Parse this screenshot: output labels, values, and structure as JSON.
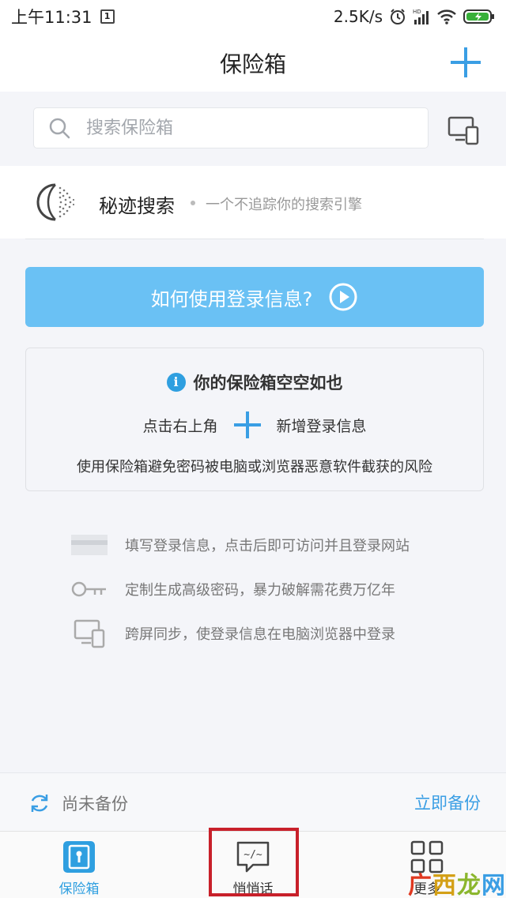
{
  "status_bar": {
    "time": "上午11:31",
    "sim": "1",
    "net_speed": "2.5K/s"
  },
  "header": {
    "title": "保险箱",
    "add_icon": "plus-icon"
  },
  "search": {
    "placeholder": "搜索保险箱",
    "devices_icon": "devices-icon"
  },
  "secret_search": {
    "title": "秘迹搜索",
    "description": "一个不追踪你的搜索引擎"
  },
  "howto": {
    "label": "如何使用登录信息?"
  },
  "empty_state": {
    "title": "你的保险箱空空如也",
    "hint_left": "点击右上角",
    "hint_right": "新增登录信息",
    "description": "使用保险箱避免密码被电脑或浏览器恶意软件截获的风险"
  },
  "features": [
    {
      "icon": "card-icon",
      "text": "填写登录信息，点击后即可访问并且登录网站"
    },
    {
      "icon": "key-icon",
      "text": "定制生成高级密码，暴力破解需花费万亿年"
    },
    {
      "icon": "devices-icon",
      "text": "跨屏同步，使登录信息在电脑浏览器中登录"
    }
  ],
  "backup": {
    "status": "尚未备份",
    "action": "立即备份"
  },
  "tabs": [
    {
      "label": "保险箱",
      "icon": "safe-icon",
      "active": true
    },
    {
      "label": "悄悄话",
      "icon": "chat-code-icon",
      "active": false
    },
    {
      "label": "更多",
      "icon": "grid-icon",
      "active": false
    }
  ],
  "watermark": [
    "广",
    "西",
    "龙",
    "网"
  ],
  "colors": {
    "accent": "#3a9ee4",
    "howto_bg": "#6ac1f4",
    "page_bg": "#f4f5f9",
    "highlight": "#c8202a"
  }
}
